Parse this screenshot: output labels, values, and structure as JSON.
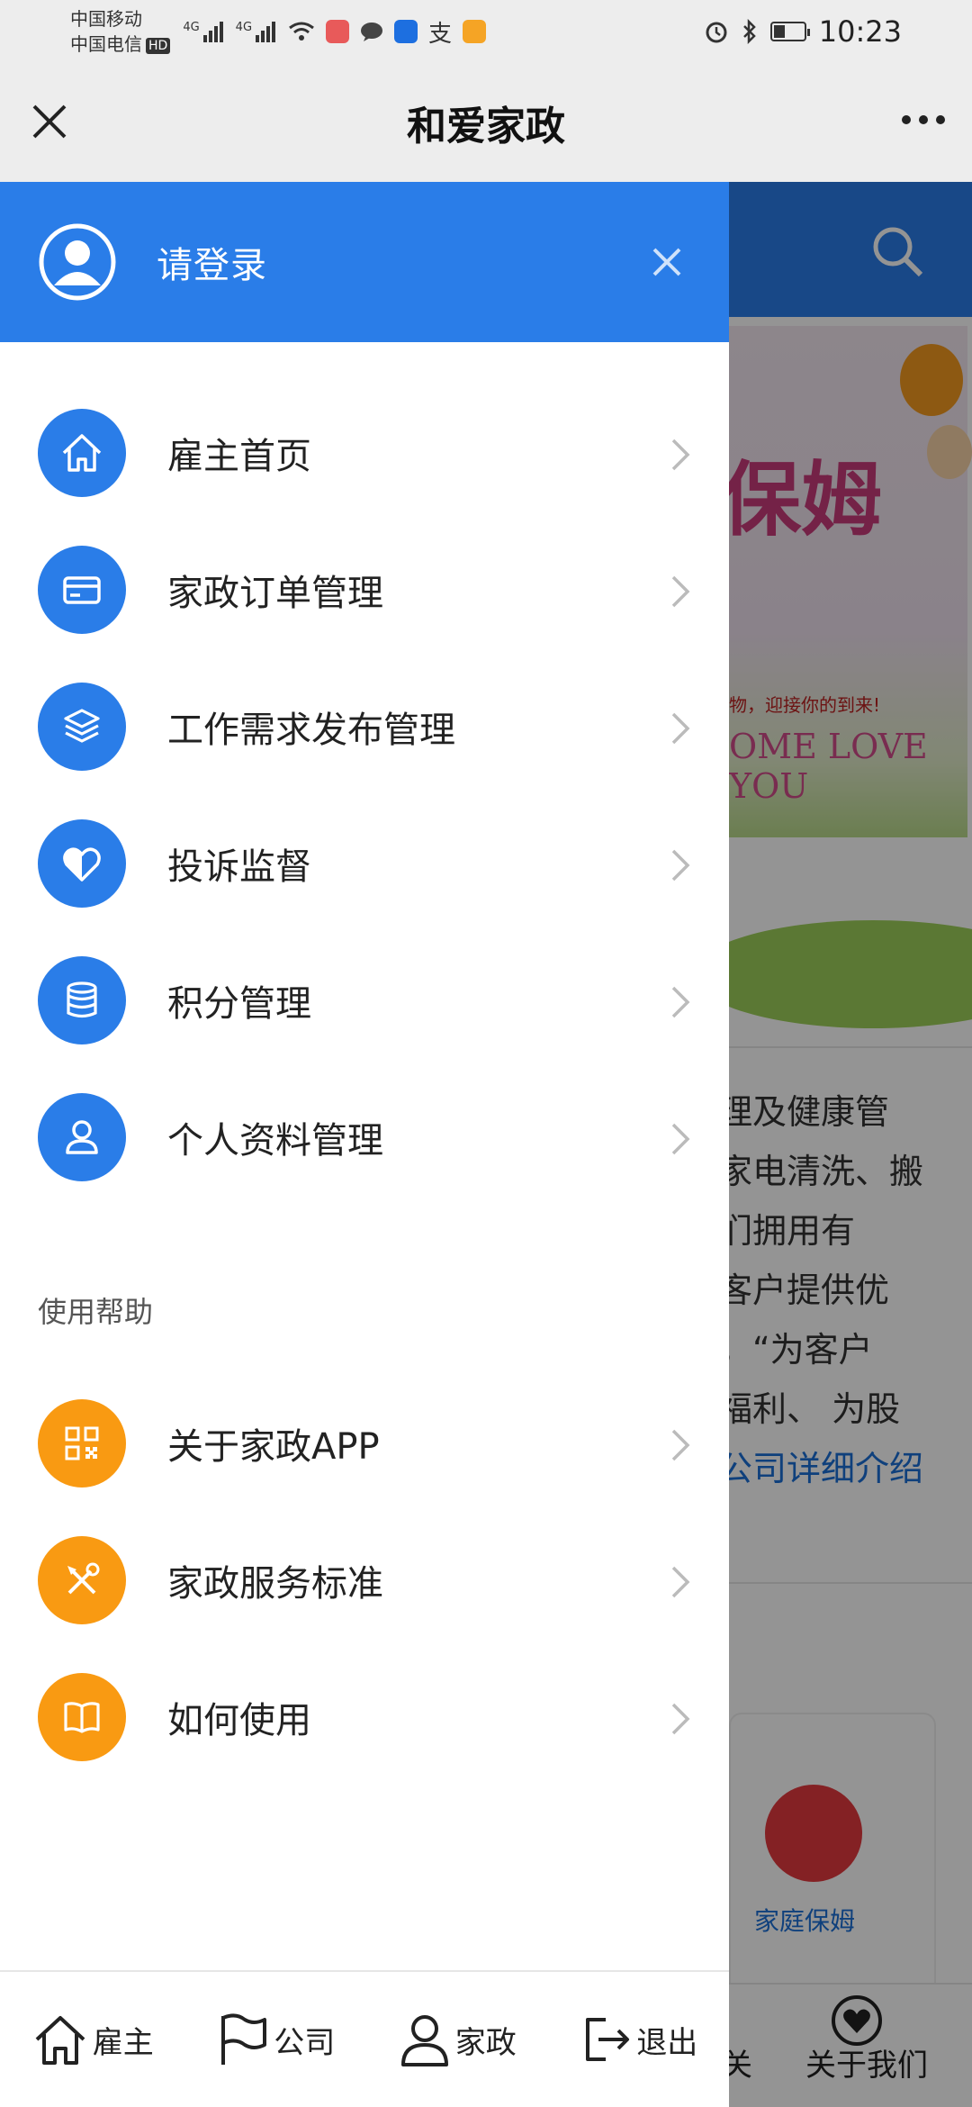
{
  "status_bar": {
    "carrier1": "中国移动",
    "carrier2": "中国电信",
    "hd_badge": "HD",
    "network1": "4G",
    "network2": "4G",
    "time": "10:23"
  },
  "title_bar": {
    "title": "和爱家政"
  },
  "drawer": {
    "login_text": "请登录",
    "menu": [
      {
        "label": "雇主首页",
        "icon": "home-icon"
      },
      {
        "label": "家政订单管理",
        "icon": "card-icon"
      },
      {
        "label": "工作需求发布管理",
        "icon": "layers-icon"
      },
      {
        "label": "投诉监督",
        "icon": "heart-icon"
      },
      {
        "label": "积分管理",
        "icon": "database-icon"
      },
      {
        "label": "个人资料管理",
        "icon": "user-icon"
      }
    ],
    "help_section": "使用帮助",
    "help_menu": [
      {
        "label": "关于家政APP",
        "icon": "qrcode-icon"
      },
      {
        "label": "家政服务标准",
        "icon": "tools-icon"
      },
      {
        "label": "如何使用",
        "icon": "book-icon"
      }
    ],
    "bottom_nav": [
      {
        "label": "雇主",
        "icon": "home-icon"
      },
      {
        "label": "公司",
        "icon": "flag-icon"
      },
      {
        "label": "家政",
        "icon": "user-icon"
      },
      {
        "label": "退出",
        "icon": "logout-icon"
      }
    ]
  },
  "background_page": {
    "banner_title": "保姆",
    "banner_sub": "物，迎接你的到来!",
    "banner_english": "OME LOVE YOU",
    "intro_lines": [
      "理及健康管",
      "家电清洗、搬",
      "们拥用有",
      "客户提供优",
      "，“为客户",
      "福利、 为股"
    ],
    "intro_link": "公司详细介绍",
    "card_label": "家庭保姆",
    "nav_partial": "关",
    "nav_about": "关于我们"
  },
  "colors": {
    "primary": "#2a7de8",
    "help_orange": "#f99a12"
  }
}
